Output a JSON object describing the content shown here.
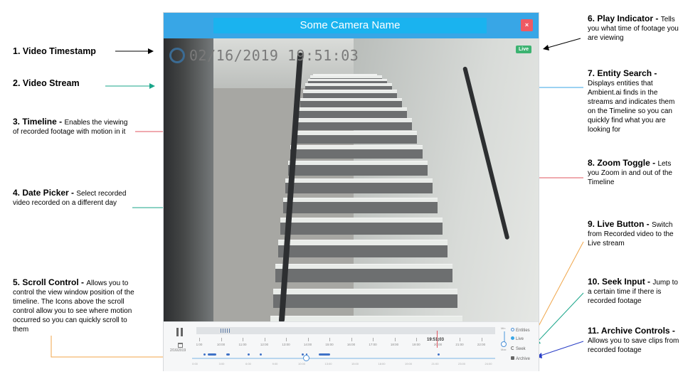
{
  "player": {
    "camera_name": "Some Camera Name",
    "close_label": "×",
    "timestamp": "02/16/2019 19:51:03",
    "live_badge": "Live",
    "date_label": "2/16/2019",
    "cursor_time": "19:51:03",
    "timeline_ticks": [
      "1:00",
      "10:00",
      "11:00",
      "12:00",
      "13:00",
      "14:00",
      "15:00",
      "16:00",
      "17:00",
      "18:00",
      "19:00",
      "20:00",
      "21:00",
      "22:00"
    ],
    "scroll_ticks": [
      "0:00",
      "3:00",
      "6:00",
      "9:00",
      "10:00",
      "13:00",
      "15:00",
      "18:00",
      "19:00",
      "21:00",
      "23:00",
      "24:00"
    ],
    "zoom_min": "Min",
    "zoom_max": "Max",
    "entities_label": "Entities",
    "live_label": "Live",
    "seek_label": "Seek",
    "archive_label": "Archive"
  },
  "annotations": {
    "a1": {
      "title": "1. Video Timestamp",
      "desc": ""
    },
    "a2": {
      "title": "2. Video Stream",
      "desc": ""
    },
    "a3": {
      "title": "3. Timeline - ",
      "desc": "Enables the viewing  of recorded footage with motion in it"
    },
    "a4": {
      "title": "4. Date Picker - ",
      "desc": "Select recorded video recorded on a different day"
    },
    "a5": {
      "title": "5. Scroll Control - ",
      "desc": "Allows you to control the view window position of the timeline. The Icons above the scroll control allow you to see where motion occurred so you can quickly scroll to them"
    },
    "a6": {
      "title": "6. Play Indicator - ",
      "desc": "Tells you what time of footage you are viewing"
    },
    "a7": {
      "title": "7. Entity Search - ",
      "desc": "Displays entities that Ambient.ai finds in the streams and indicates them on the Timeline so you can quickly find what you are looking for"
    },
    "a8": {
      "title": "8. Zoom Toggle - ",
      "desc": "Lets you Zoom in and out of the Timeline"
    },
    "a9": {
      "title": "9. Live Button - ",
      "desc": "Switch from Recorded video to the Live stream"
    },
    "a10": {
      "title": "10. Seek Input - ",
      "desc": "Jump to a certain time if there is recorded footage"
    },
    "a11": {
      "title": "11. Archive Controls - ",
      "desc": "Allows you to save clips from recorded footage"
    }
  },
  "colors": {
    "title_bar": "#38a6e6",
    "title_box": "#1ab3ef",
    "close": "#ef5a63",
    "live_badge": "#3cb371",
    "timeline_blob": "#3f72c7",
    "cursor": "#e0555f"
  },
  "icons": [
    "close-icon",
    "loading-circle-icon",
    "pause-icon",
    "calendar-icon",
    "search-icon",
    "live-dot-icon",
    "seek-icon",
    "archive-icon"
  ]
}
